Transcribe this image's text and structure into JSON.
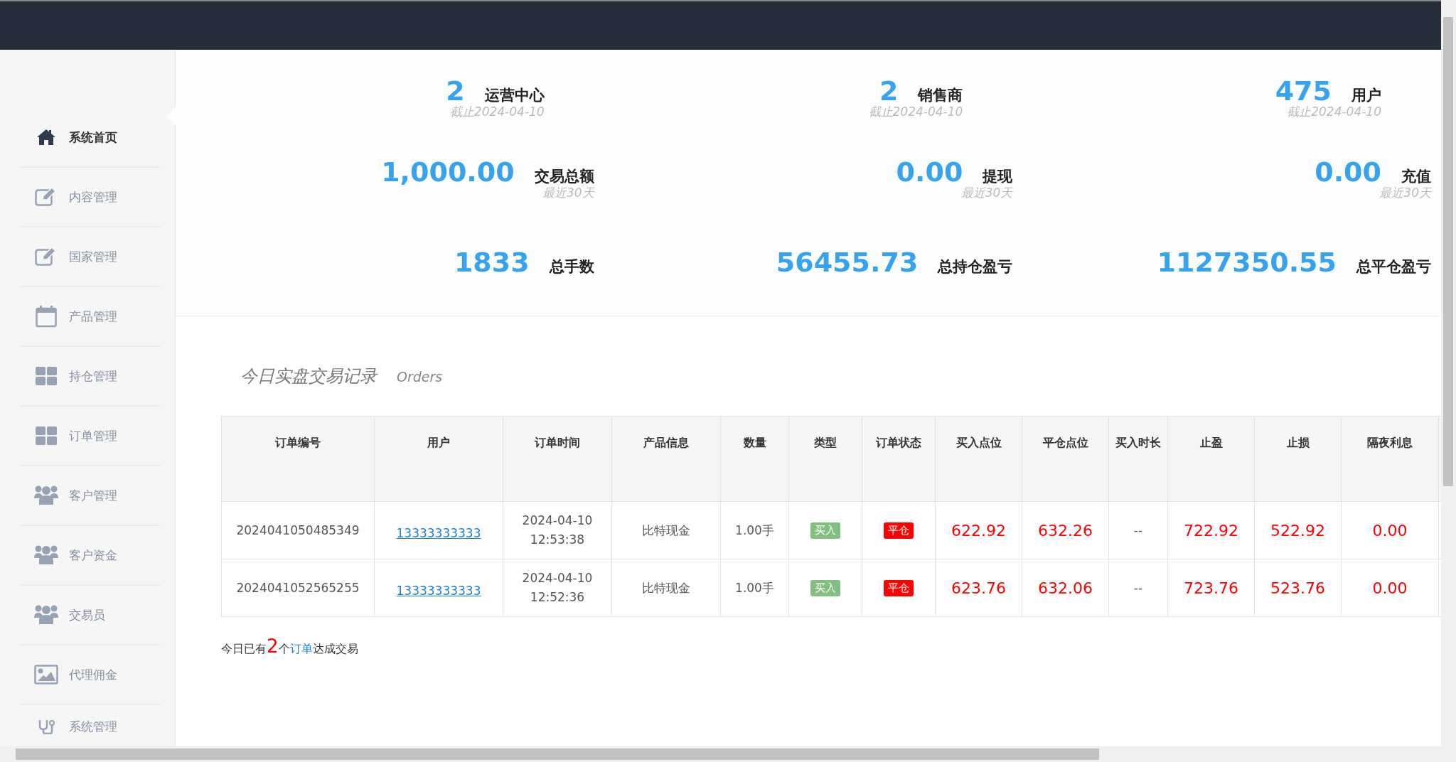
{
  "sidebar": {
    "items": [
      {
        "label": "系统首页",
        "selected": true
      },
      {
        "label": "内容管理",
        "selected": false
      },
      {
        "label": "国家管理",
        "selected": false
      },
      {
        "label": "产品管理",
        "selected": false
      },
      {
        "label": "持仓管理",
        "selected": false
      },
      {
        "label": "订单管理",
        "selected": false
      },
      {
        "label": "客户管理",
        "selected": false
      },
      {
        "label": "客户资金",
        "selected": false
      },
      {
        "label": "交易员",
        "selected": false
      },
      {
        "label": "代理佣金",
        "selected": false
      },
      {
        "label": "系统管理",
        "selected": false
      }
    ]
  },
  "stats": [
    {
      "value": "2",
      "label": "运营中心",
      "note": "截止2024-04-10"
    },
    {
      "value": "2",
      "label": "销售商",
      "note": "截止2024-04-10"
    },
    {
      "value": "475",
      "label": "用户",
      "note": "截止2024-04-10"
    },
    {
      "value": "1,000.00",
      "label": "交易总额",
      "note": "最近30天"
    },
    {
      "value": "0.00",
      "label": "提现",
      "note": "最近30天"
    },
    {
      "value": "0.00",
      "label": "充值",
      "note": "最近30天"
    },
    {
      "value": "1833",
      "label": "总手数"
    },
    {
      "value": "56455.73",
      "label": "总持仓盈亏"
    },
    {
      "value": "1127350.55",
      "label": "总平仓盈亏"
    }
  ],
  "orders": {
    "title": "今日实盘交易记录",
    "subtitle": "Orders",
    "columns": [
      "订单编号",
      "用户",
      "订单时间",
      "产品信息",
      "数量",
      "类型",
      "订单状态",
      "买入点位",
      "平仓点位",
      "买入时长",
      "止盈",
      "止损",
      "隔夜利息"
    ],
    "rows": [
      {
        "id": "2024041050485349",
        "user": "13333333333",
        "date": "2024-04-10",
        "time": "12:53:38",
        "product": "比特现金",
        "qty": "1.00手",
        "type": {
          "text": "买入",
          "kind": "buy"
        },
        "status": {
          "text": "平仓",
          "kind": "closed"
        },
        "buy_price": "622.92",
        "close_price": "632.26",
        "duration": "--",
        "take_profit": "722.92",
        "stop_loss": "522.92",
        "overnight": "0.00"
      },
      {
        "id": "2024041052565255",
        "user": "13333333333",
        "date": "2024-04-10",
        "time": "12:52:36",
        "product": "比特现金",
        "qty": "1.00手",
        "type": {
          "text": "买入",
          "kind": "buy"
        },
        "status": {
          "text": "平仓",
          "kind": "closed"
        },
        "buy_price": "623.76",
        "close_price": "632.06",
        "duration": "--",
        "take_profit": "723.76",
        "stop_loss": "523.76",
        "overnight": "0.00"
      }
    ],
    "summary": {
      "prefix": "今日已有",
      "count": "2",
      "middle": "个",
      "link": "订单",
      "suffix": "达成交易"
    }
  }
}
